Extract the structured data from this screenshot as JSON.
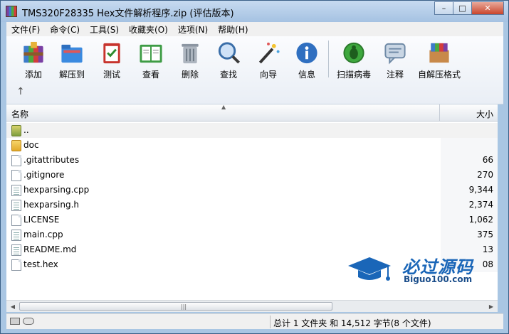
{
  "window": {
    "title": "TMS320F28335 Hex文件解析程序.zip (评估版本)",
    "minimize": "–",
    "maximize": "□",
    "close": "✕"
  },
  "menu": [
    "文件(F)",
    "命令(C)",
    "工具(S)",
    "收藏夹(O)",
    "选项(N)",
    "帮助(H)"
  ],
  "toolbar": {
    "add": "添加",
    "extract": "解压到",
    "test": "测试",
    "view": "查看",
    "delete": "删除",
    "find": "查找",
    "wizard": "向导",
    "info": "信息",
    "virus": "扫描病毒",
    "comment": "注释",
    "sfx": "自解压格式",
    "up": "↑"
  },
  "list": {
    "col_name": "名称",
    "col_size": "大小",
    "sort_indicator": "▲",
    "rows": [
      {
        "name": "..",
        "size": "",
        "icon": "up-folder-icon"
      },
      {
        "name": "doc",
        "size": "",
        "icon": "folder-icon"
      },
      {
        "name": ".gitattributes",
        "size": "66",
        "icon": "file-icon"
      },
      {
        "name": ".gitignore",
        "size": "270",
        "icon": "file-icon"
      },
      {
        "name": "hexparsing.cpp",
        "size": "9,344",
        "icon": "cpp-file-icon"
      },
      {
        "name": "hexparsing.h",
        "size": "2,374",
        "icon": "header-file-icon"
      },
      {
        "name": "LICENSE",
        "size": "1,062",
        "icon": "file-icon"
      },
      {
        "name": "main.cpp",
        "size": "375",
        "icon": "cpp-file-icon"
      },
      {
        "name": "README.md",
        "size": "13",
        "icon": "markdown-file-icon"
      },
      {
        "name": "test.hex",
        "size": "08",
        "icon": "file-icon"
      }
    ]
  },
  "watermark": {
    "big": "必过源码",
    "small": "Biguo100.com"
  },
  "scrollbar": {
    "left": "◀",
    "right": "▶",
    "grip": "|||"
  },
  "status": {
    "text": "总计 1 文件夹 和 14,512 字节(8 个文件)"
  },
  "colors": {
    "titlebar": "#a9c6e3",
    "accent": "#1a66b8"
  }
}
